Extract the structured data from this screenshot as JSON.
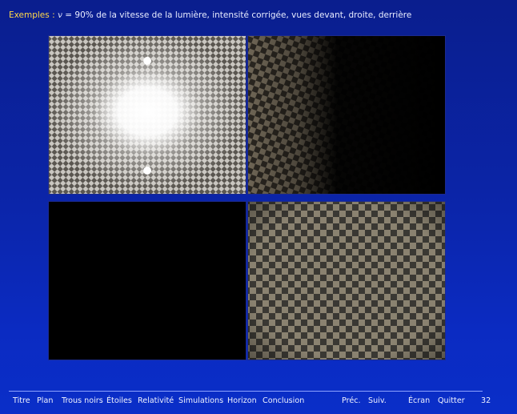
{
  "header": {
    "label": "Exemples :",
    "symbol": "v",
    "equals": "=",
    "value": "90%",
    "text": "de la vitesse de la lumière, intensité corrigée, vues devant, droite, derrière"
  },
  "footer": {
    "nav": [
      "Titre",
      "Plan",
      "Trous noirs",
      "Étoiles",
      "Relativité",
      "Simulations",
      "Horizon",
      "Conclusion"
    ],
    "prev": "Préc.",
    "next": "Suiv.",
    "screen": "Écran",
    "quit": "Quitter",
    "page": "32"
  },
  "colors": {
    "background": "#0b24a6",
    "accent": "#ffd84a",
    "checker_light": "#8a8270",
    "checker_dark": "#3a3833"
  }
}
